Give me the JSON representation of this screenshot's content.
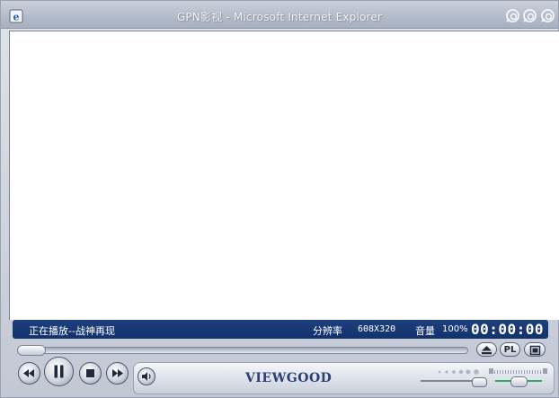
{
  "window": {
    "title": "GPN影视 - Microsoft Internet Explorer",
    "icon": "internet-explorer-icon"
  },
  "status": {
    "now_playing": "正在播放--战神再现",
    "resolution_label": "分辨率",
    "resolution_value": "608X320",
    "volume_label": "音量",
    "volume_value": "100%",
    "timer": "00:00:00"
  },
  "controls": {
    "rewind_icon": "rewind-icon",
    "pause_icon": "pause-icon",
    "stop_icon": "stop-icon",
    "fast_forward_icon": "fast-forward-icon",
    "mute_icon": "speaker-icon",
    "eject_icon": "eject-icon",
    "playlist_label": "PL",
    "fullscreen_icon": "fullscreen-icon"
  },
  "brand": "VIEWGOOD",
  "playback": {
    "progress": 0,
    "volume_level": 0.85,
    "balance": 0.5
  },
  "colors": {
    "status_bar": "#17377a",
    "accent_green": "#2fa86a"
  }
}
